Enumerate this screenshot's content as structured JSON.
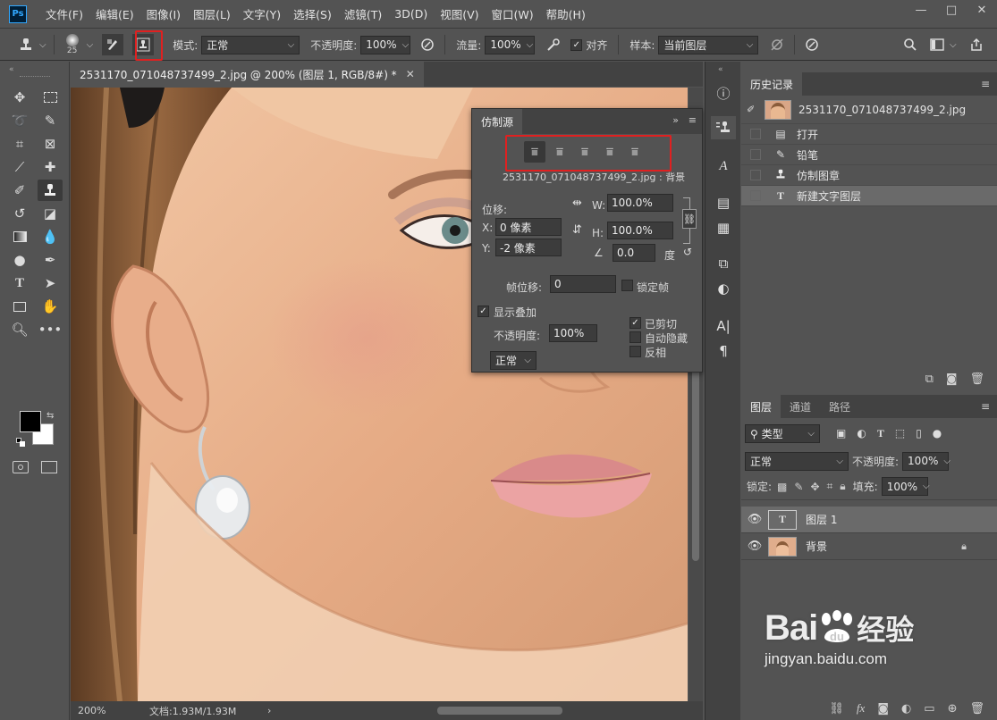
{
  "app": {
    "logo": "Ps"
  },
  "menu": [
    "文件(F)",
    "编辑(E)",
    "图像(I)",
    "图层(L)",
    "文字(Y)",
    "选择(S)",
    "滤镜(T)",
    "3D(D)",
    "视图(V)",
    "窗口(W)",
    "帮助(H)"
  ],
  "window_controls": {
    "minimize": "—",
    "maximize": "□",
    "close": "✕"
  },
  "options": {
    "brush_size": "25",
    "mode_label": "模式:",
    "mode_value": "正常",
    "opacity_label": "不透明度:",
    "opacity_value": "100%",
    "flow_label": "流量:",
    "flow_value": "100%",
    "aligned_label": "对齐",
    "aligned_checked": true,
    "sample_label": "样本:",
    "sample_value": "当前图层"
  },
  "document": {
    "tab_title": "2531170_071048737499_2.jpg @ 200% (图层 1, RGB/8#) *",
    "zoom": "200%",
    "doc_info": "文档:1.93M/1.93M"
  },
  "clone_source": {
    "title": "仿制源",
    "source_file": "2531170_071048737499_2.jpg : 背景",
    "offset_label": "位移:",
    "x_label": "X:",
    "x_value": "0 像素",
    "y_label": "Y:",
    "y_value": "-2 像素",
    "w_label": "W:",
    "w_value": "100.0%",
    "h_label": "H:",
    "h_value": "100.0%",
    "angle_value": "0.0",
    "angle_unit": "度",
    "frame_offset_label": "帧位移:",
    "frame_offset_value": "0",
    "lock_frame_label": "锁定帧",
    "show_overlay_label": "显示叠加",
    "show_overlay_checked": true,
    "overlay_opacity_label": "不透明度:",
    "overlay_opacity_value": "100%",
    "blend_mode": "正常",
    "clipped_label": "已剪切",
    "clipped_checked": true,
    "auto_hide_label": "自动隐藏",
    "invert_label": "反相"
  },
  "history": {
    "title": "历史记录",
    "snapshot": "2531170_071048737499_2.jpg",
    "items": [
      {
        "icon": "document-icon",
        "label": "打开"
      },
      {
        "icon": "pencil-icon",
        "label": "铅笔"
      },
      {
        "icon": "clone-stamp-icon",
        "label": "仿制图章"
      },
      {
        "icon": "type-icon",
        "label": "新建文字图层"
      }
    ]
  },
  "layers": {
    "tabs": [
      "图层",
      "通道",
      "路径"
    ],
    "filter_kind": "类型",
    "blend_mode": "正常",
    "opacity_label": "不透明度:",
    "opacity_value": "100%",
    "lock_label": "锁定:",
    "fill_label": "填充:",
    "fill_value": "100%",
    "items": [
      {
        "name": "图层 1",
        "type": "text"
      },
      {
        "name": "背景",
        "type": "image"
      }
    ]
  },
  "watermark": {
    "brand": "Bai",
    "brand_suffix": "经验",
    "url": "jingyan.baidu.com"
  },
  "colors": {
    "accent_red": "#e02020",
    "panel_bg": "#535353",
    "dark_bg": "#424242",
    "selection": "#6a6a6a"
  }
}
